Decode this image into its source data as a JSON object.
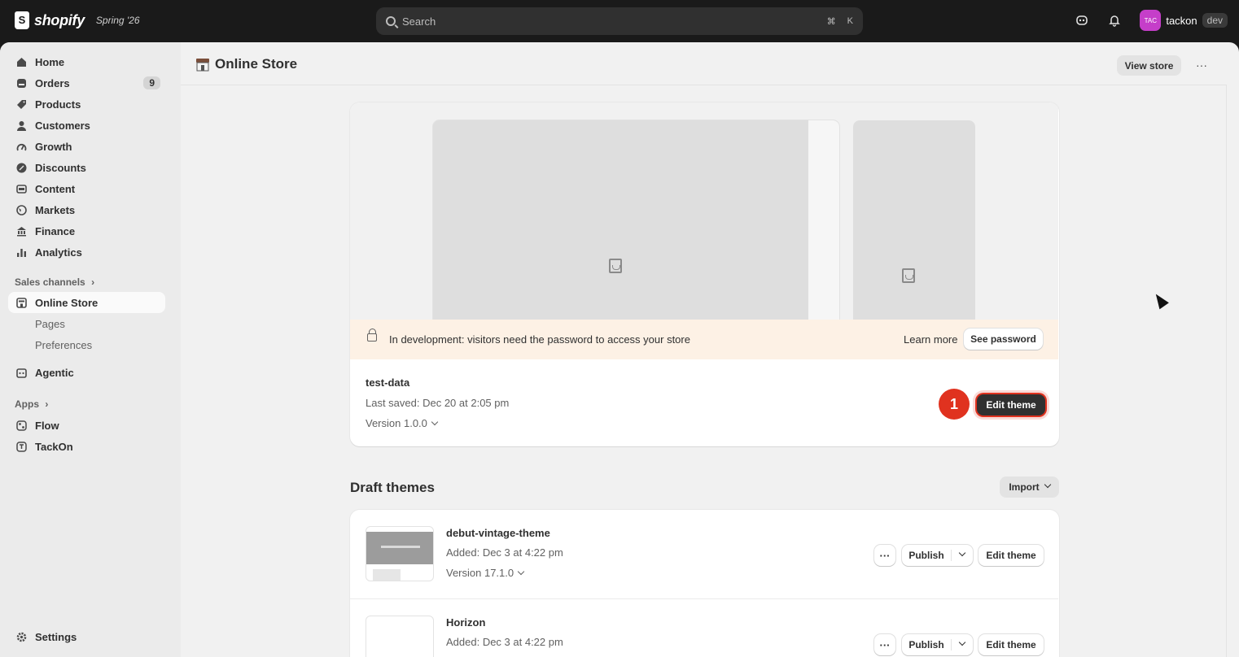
{
  "topbar": {
    "logo_text": "shopify",
    "season": "Spring '26",
    "search_placeholder": "Search",
    "shortcut_cmd": "⌘",
    "shortcut_key": "K",
    "avatar_initials": "TAC",
    "account_name": "tackon",
    "env_badge": "dev"
  },
  "sidebar": {
    "items": [
      {
        "label": "Home",
        "icon": "home-icon"
      },
      {
        "label": "Orders",
        "icon": "orders-icon",
        "badge": "9"
      },
      {
        "label": "Products",
        "icon": "tag-icon"
      },
      {
        "label": "Customers",
        "icon": "person-icon"
      },
      {
        "label": "Growth",
        "icon": "growth-icon"
      },
      {
        "label": "Discounts",
        "icon": "discount-icon"
      },
      {
        "label": "Content",
        "icon": "content-icon"
      },
      {
        "label": "Markets",
        "icon": "globe-icon"
      },
      {
        "label": "Finance",
        "icon": "bank-icon"
      },
      {
        "label": "Analytics",
        "icon": "chart-icon"
      }
    ],
    "sales_channels_label": "Sales channels",
    "online_store": "Online Store",
    "sub_pages": "Pages",
    "sub_preferences": "Preferences",
    "agentic": "Agentic",
    "apps_label": "Apps",
    "flow": "Flow",
    "tackon": "TackOn",
    "settings": "Settings"
  },
  "header": {
    "title": "Online Store",
    "view_store": "View store",
    "more": "···"
  },
  "current_theme": {
    "banner_text": "In development: visitors need the password to access your store",
    "learn_more": "Learn more",
    "see_password": "See password",
    "name": "test-data",
    "last_saved": "Last saved: Dec 20 at 2:05 pm",
    "version": "Version 1.0.0",
    "edit_theme": "Edit theme",
    "step_marker": "1"
  },
  "drafts": {
    "title": "Draft themes",
    "import": "Import",
    "rows": [
      {
        "name": "debut-vintage-theme",
        "added": "Added: Dec 3 at 4:22 pm",
        "version": "Version 17.1.0",
        "more": "···",
        "publish": "Publish",
        "edit": "Edit theme"
      },
      {
        "name": "Horizon",
        "added": "Added: Dec 3 at 4:22 pm",
        "more": "···",
        "publish": "Publish",
        "edit": "Edit theme"
      }
    ]
  },
  "colors": {
    "topbar_bg": "#1a1a1a",
    "accent_marker": "#e0321f",
    "banner_bg": "#fdf1e5",
    "avatar_bg": "#c53ec9"
  }
}
